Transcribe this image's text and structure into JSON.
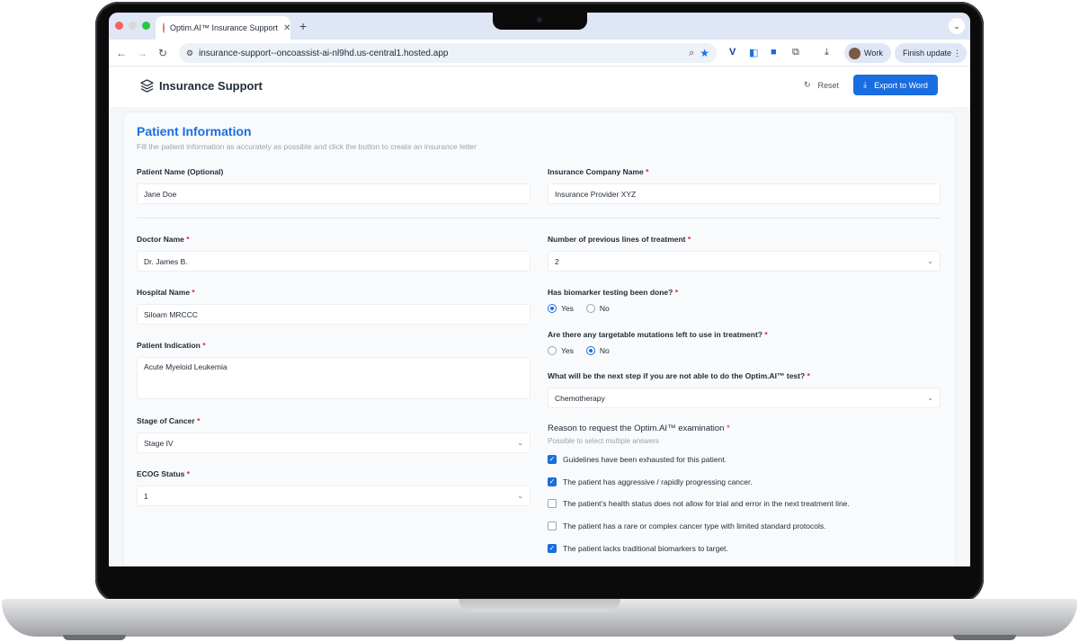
{
  "browser": {
    "tab_title": "Optim.AI™ Insurance Support",
    "tab_close": "✕",
    "new_tab": "+",
    "tab_menu": "⌄",
    "url": "insurance-support--oncoassist-ai-nl9hd.us-central1.hosted.app",
    "profile_label": "Work",
    "finish_update": "Finish update",
    "more": "⋮",
    "dot_colors": [
      "#ff5f57",
      "#d6d8dc",
      "#28c840"
    ]
  },
  "app": {
    "brand": "Insurance Support",
    "reset_label": "Reset",
    "reset_icon": "↻",
    "export_label": "Export to Word",
    "export_icon": "⤓"
  },
  "form": {
    "title": "Patient Information",
    "subtitle": "Fill the patient information as accurately as possible and click the button to create an insurance letter",
    "required_mark": "*",
    "patient_name": {
      "label": "Patient Name (Optional)",
      "value": "Jane Doe"
    },
    "insurance_company": {
      "label": "Insurance Company Name",
      "value": "Insurance Provider XYZ"
    },
    "doctor_name": {
      "label": "Doctor Name",
      "value": "Dr. James B."
    },
    "previous_lines": {
      "label": "Number of previous lines of treatment",
      "value": "2"
    },
    "hospital_name": {
      "label": "Hospital Name",
      "value": "Siloam MRCCC"
    },
    "biomarker_testing": {
      "label": "Has biomarker testing been done?",
      "options": [
        "Yes",
        "No"
      ],
      "selected": "Yes"
    },
    "targetable_mutations": {
      "label": "Are there any targetable mutations left to use in treatment?",
      "options": [
        "Yes",
        "No"
      ],
      "selected": "No"
    },
    "patient_indication": {
      "label": "Patient Indication",
      "value": "Acute Myeloid Leukemia"
    },
    "next_step": {
      "label": "What will be the next step if you are not able to do the Optim.AI™ test?",
      "value": "Chemotherapy"
    },
    "stage_of_cancer": {
      "label": "Stage of Cancer",
      "value": "Stage IV"
    },
    "ecog_status": {
      "label": "ECOG Status",
      "value": "1"
    },
    "reason": {
      "label": "Reason to request the Optim.AI™ examination",
      "hint": "Possible to select multiple answers",
      "options": [
        {
          "text": "Guidelines have been exhausted for this patient.",
          "checked": true
        },
        {
          "text": "The patient has aggressive / rapidly progressing cancer.",
          "checked": true
        },
        {
          "text": "The patient’s health status does not allow for trial and error in the next treatment line.",
          "checked": false
        },
        {
          "text": "The patient has a rare or complex cancer type with limited standard protocols.",
          "checked": false
        },
        {
          "text": "The patient lacks traditional biomarkers to target.",
          "checked": true
        }
      ]
    }
  },
  "colors": {
    "accent": "#1a6de0",
    "required": "#e11d48"
  }
}
